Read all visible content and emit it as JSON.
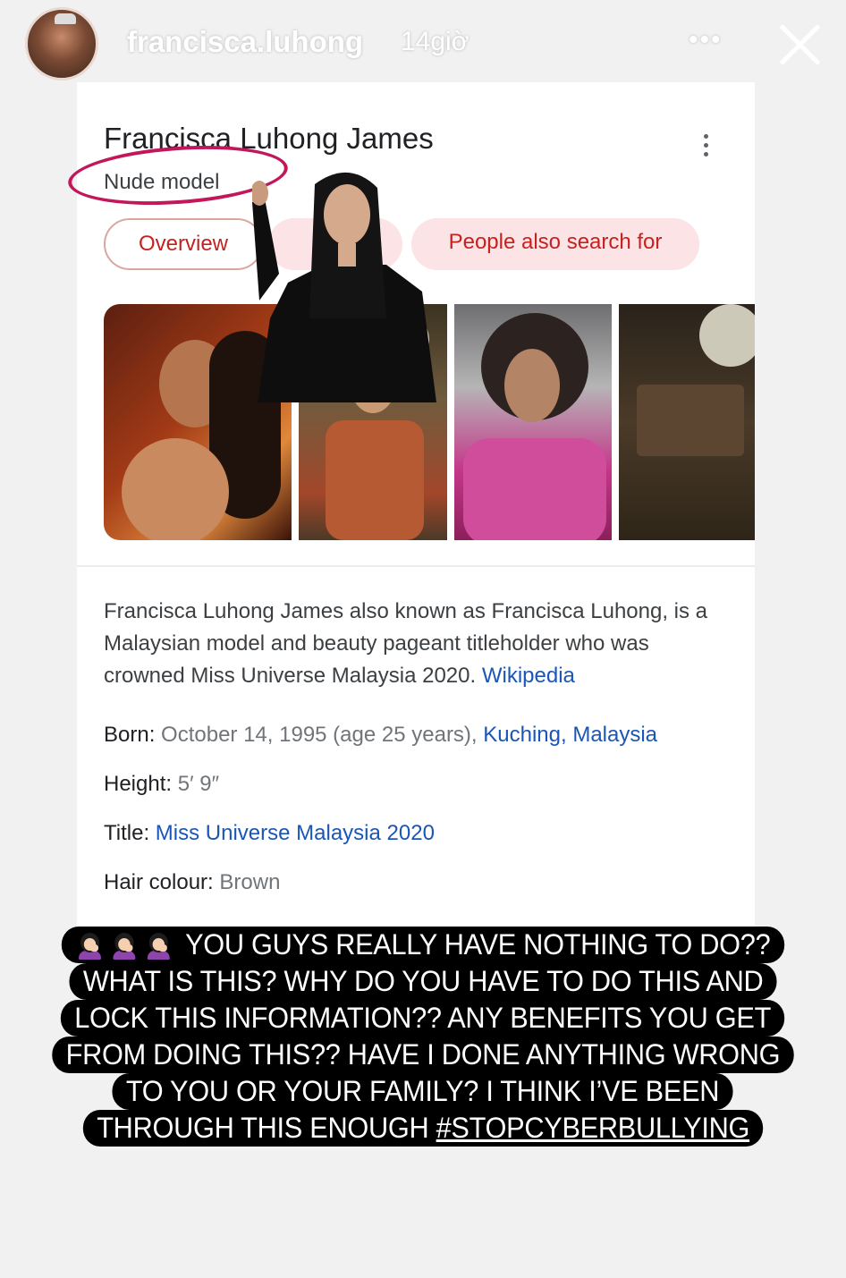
{
  "story": {
    "username": "francisca.luhong",
    "time": "14giờ",
    "more_icon": "ellipsis-icon",
    "close_icon": "close-icon"
  },
  "knowledge_panel": {
    "title": "Francisca Luhong James",
    "subtitle": "Nude model",
    "annotation_color": "#c2185b",
    "tabs": [
      {
        "label": "Overview"
      },
      {
        "label": ""
      },
      {
        "label": "People also search for"
      }
    ],
    "description": "Francisca Luhong James also known as Francisca Luhong, is a Malaysian model and beauty pageant titleholder who was crowned Miss Universe Malaysia 2020.",
    "source_link": "Wikipedia",
    "facts": {
      "born_label": "Born:",
      "born_value": "October 14, 1995 (age 25 years),",
      "born_place": "Kuching, Malaysia",
      "height_label": "Height:",
      "height_value": "5′ 9″",
      "title_label": "Title:",
      "title_value": "Miss Universe Malaysia 2020",
      "hair_label": "Hair colour:",
      "hair_value": "Brown"
    },
    "link_color": "#1a56b8"
  },
  "caption": {
    "lines": [
      "YOU GUYS REALLY HAVE NOTHING TO DO??",
      "WHAT IS THIS? WHY DO YOU HAVE TO DO THIS AND",
      "LOCK THIS INFORMATION?? ANY BENEFITS YOU GET",
      "FROM DOING THIS?? HAVE I DONE ANYTHING WRONG",
      "TO YOU OR YOUR FAMILY? I THINK I’VE BEEN",
      "THROUGH THIS ENOUGH "
    ],
    "hashtag": "#STOPCYBERBULLYING",
    "emoji": "woman-facepalming-emoji"
  }
}
